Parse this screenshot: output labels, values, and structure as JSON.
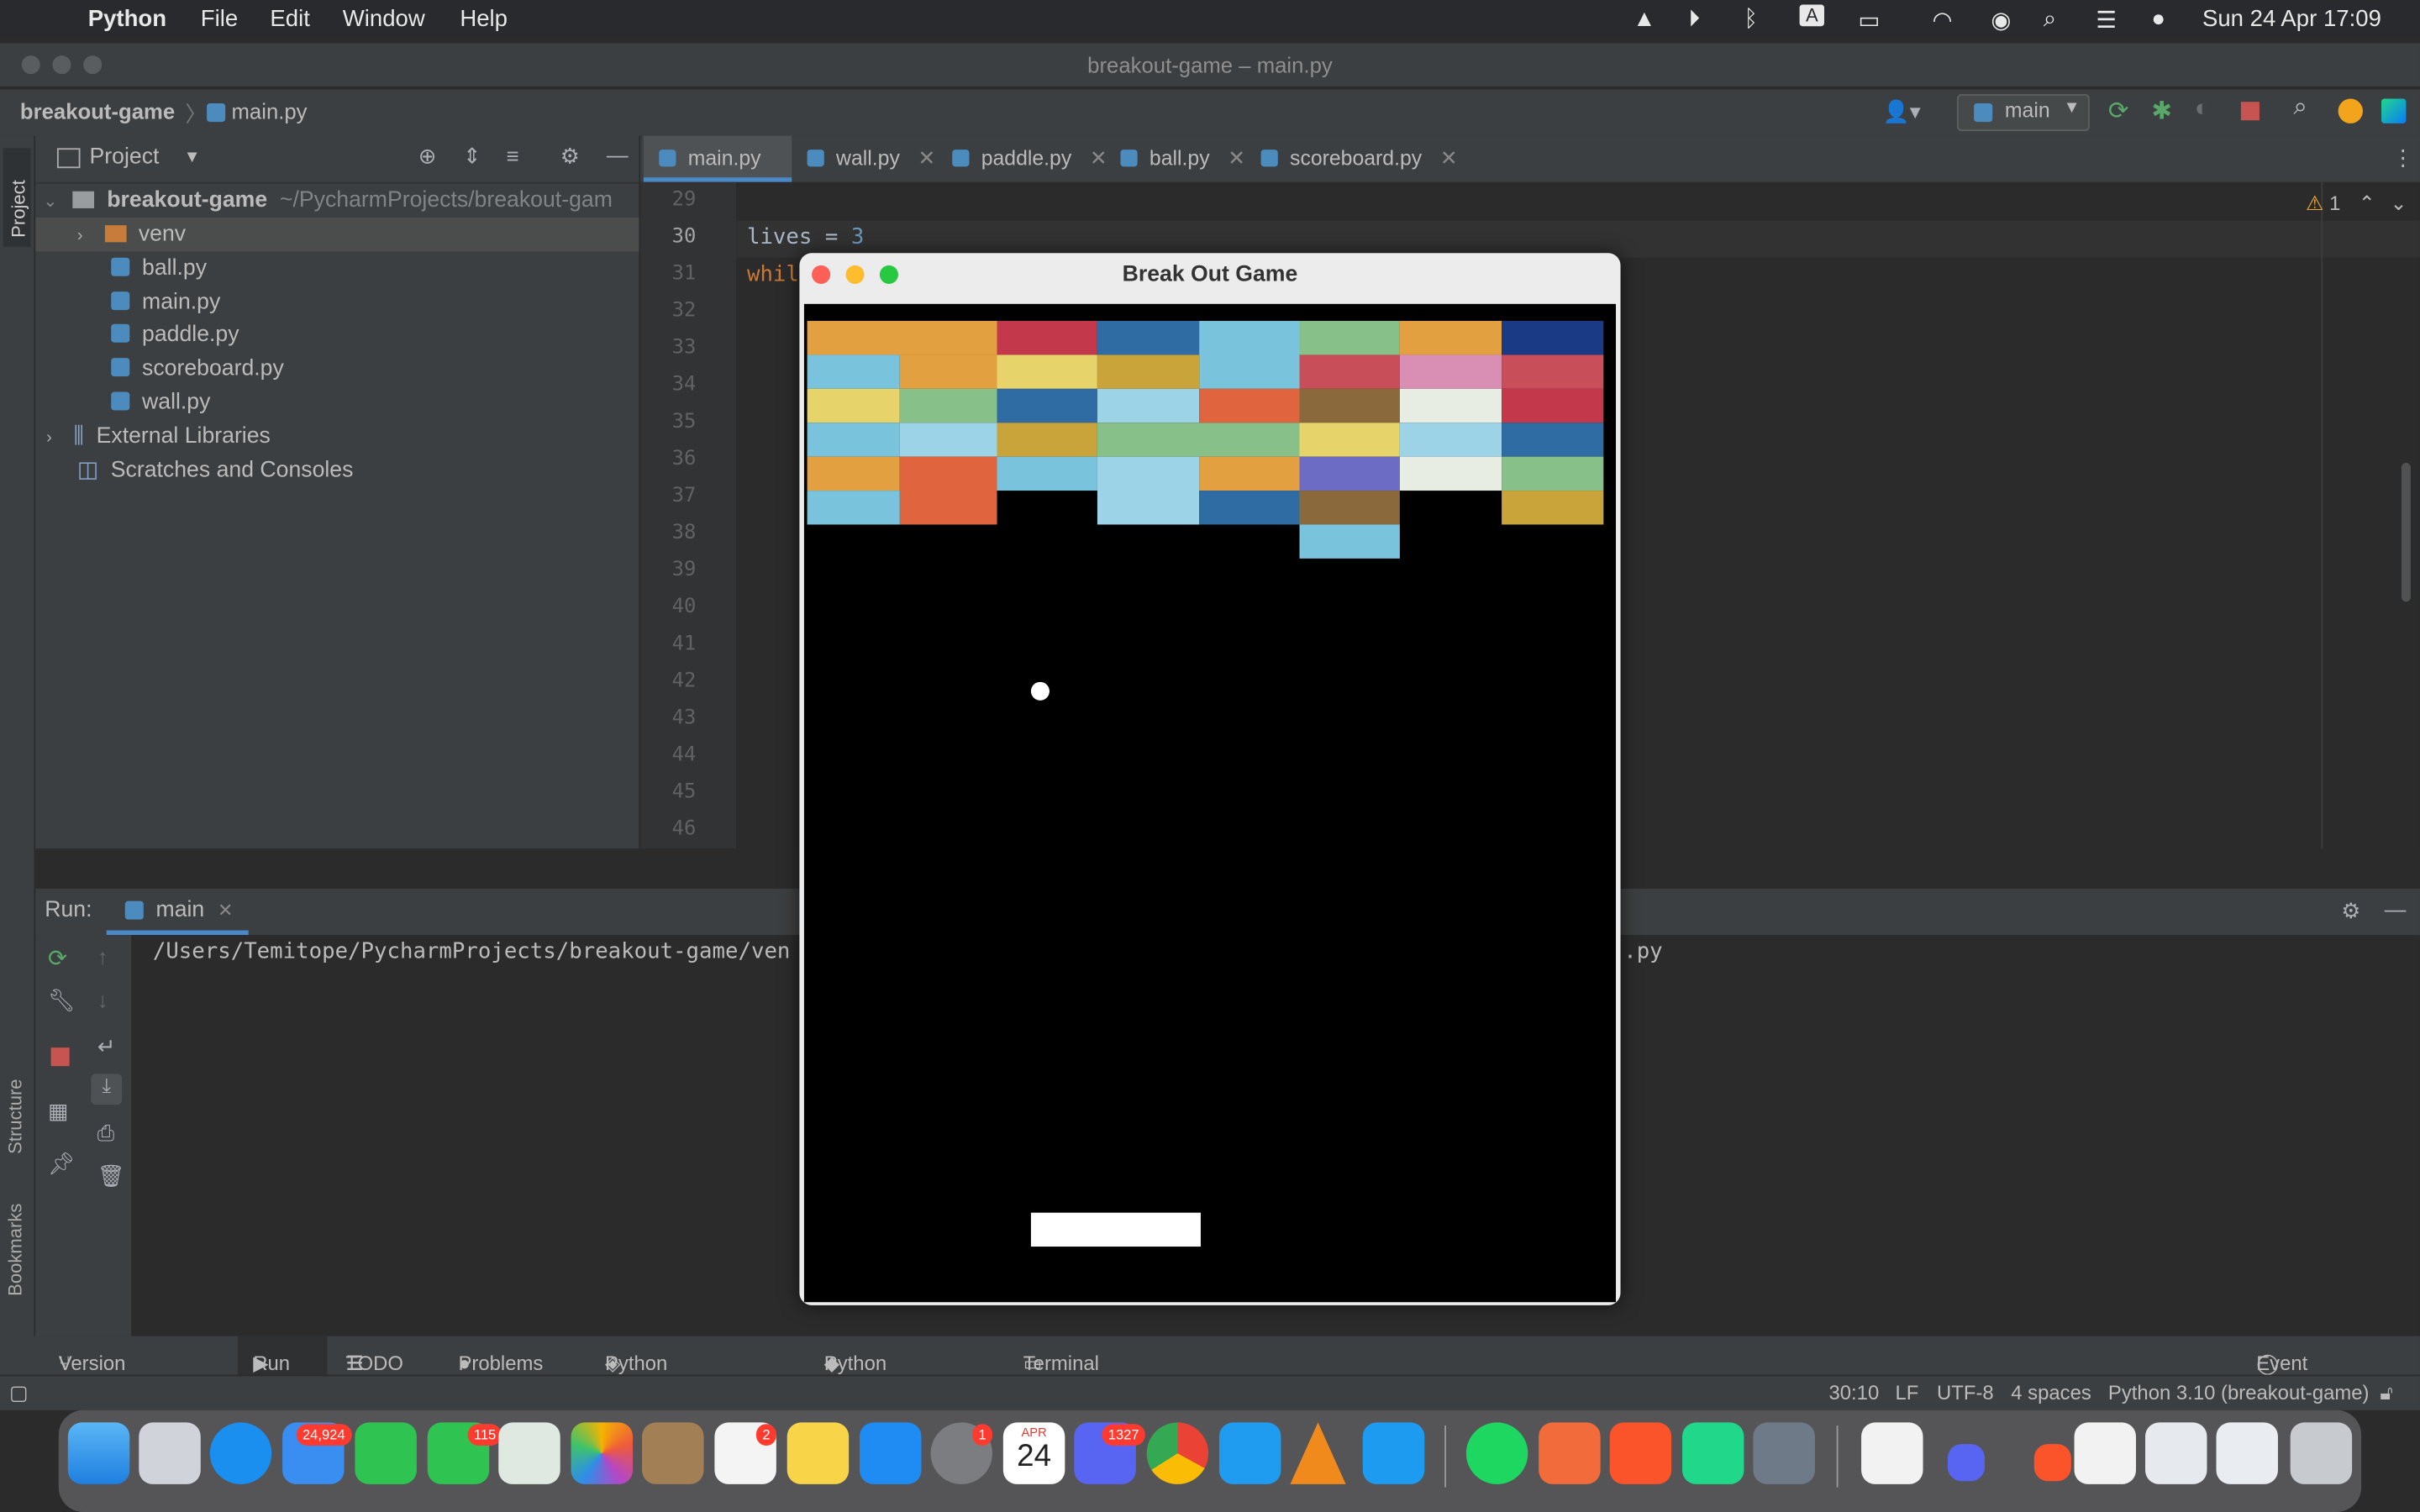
{
  "menubar": {
    "app": "Python",
    "items": [
      "File",
      "Edit",
      "Window",
      "Help"
    ],
    "clock": "Sun 24 Apr  17:09"
  },
  "window": {
    "title": "breakout-game – main.py"
  },
  "navbar": {
    "project": "breakout-game",
    "file": "main.py",
    "run_config": "main"
  },
  "project_panel": {
    "title": "Project",
    "root": "breakout-game",
    "root_path": "~/PycharmProjects/breakout-gam",
    "items": [
      "venv",
      "ball.py",
      "main.py",
      "paddle.py",
      "scoreboard.py",
      "wall.py"
    ],
    "external": "External Libraries",
    "scratches": "Scratches and Consoles"
  },
  "editor": {
    "tabs": [
      "main.py",
      "wall.py",
      "paddle.py",
      "ball.py",
      "scoreboard.py"
    ],
    "line_numbers": [
      "29",
      "30",
      "31",
      "32",
      "33",
      "34",
      "35",
      "36",
      "37",
      "38",
      "39",
      "40",
      "41",
      "42",
      "43",
      "44",
      "45",
      "46"
    ],
    "code_line_30_var": "lives",
    "code_line_30_op": " = ",
    "code_line_30_val": "3",
    "code_line_31": "whil",
    "warning_count": "1"
  },
  "run_panel": {
    "label": "Run:",
    "tab": "main",
    "command_start": "/Users/Temitope/PycharmProjects/breakout-game/ven",
    "command_end": ".py"
  },
  "game_window": {
    "title": "Break Out Game",
    "brick_colors": {
      "orange": "#e3a040",
      "red": "#c4384c",
      "blue": "#2f6ca3",
      "skyblue": "#79c4dc",
      "green": "#88c08a",
      "navy": "#1b3a86",
      "yellow": "#e6d46a",
      "gold": "#c9a43a",
      "pink": "#d98fb4",
      "rose": "#c84e5a",
      "tomato": "#e0643e",
      "brown": "#8a6a3c",
      "white": "#e7ede2",
      "lightblue": "#9dd3e6",
      "purple": "#6c6cc4"
    }
  },
  "bottom_tabs": [
    "Version Control",
    "Run",
    "TODO",
    "Problems",
    "Python Packages",
    "Python Console",
    "Terminal"
  ],
  "event_log": "Event Log",
  "status": {
    "position": "30:10",
    "line_sep": "LF",
    "encoding": "UTF-8",
    "indent": "4 spaces",
    "interpreter": "Python 3.10 (breakout-game)"
  },
  "side_labels": {
    "project": "Project",
    "structure": "Structure",
    "bookmarks": "Bookmarks"
  },
  "dock": {
    "mail_badge": "24,924",
    "messages_badge": "115",
    "reminders_badge": "2",
    "settings_badge": "1",
    "calendar_month": "APR",
    "calendar_day": "24",
    "discord_badge": "1327"
  }
}
